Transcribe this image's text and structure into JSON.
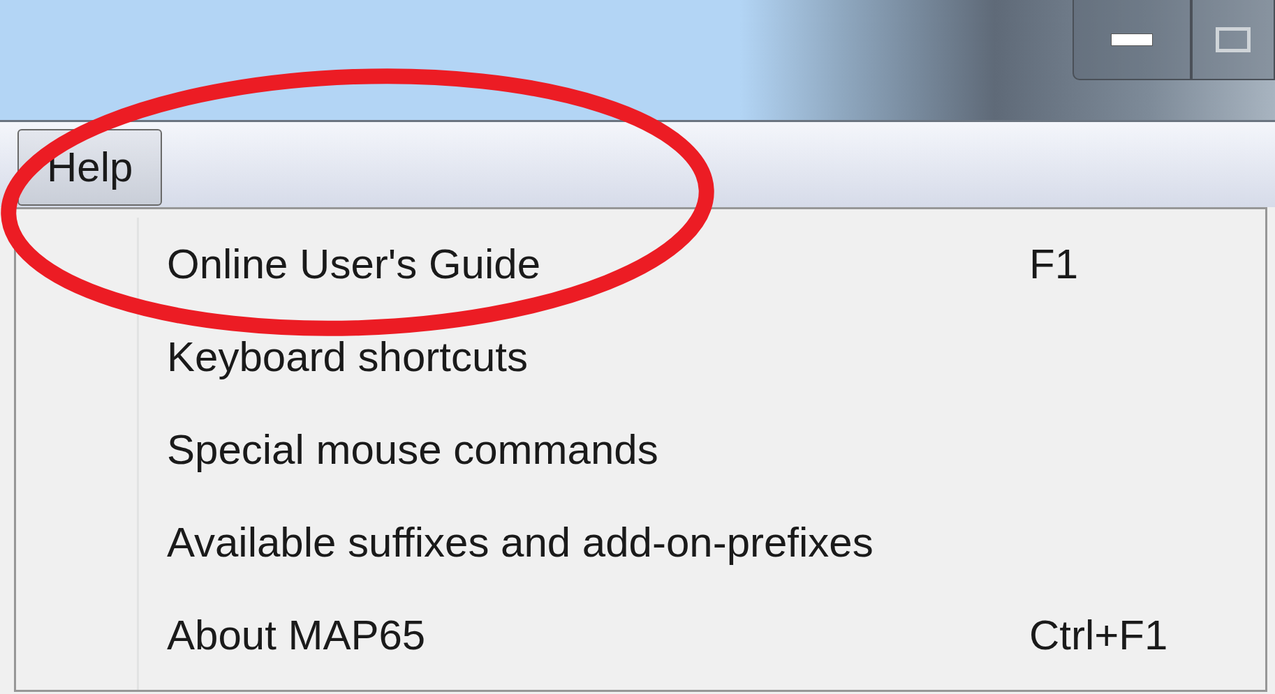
{
  "menu_bar": [
    {
      "label": "Help",
      "selected": true
    }
  ],
  "menu": {
    "items": [
      {
        "label": "Online User's Guide",
        "shortcut": "F1"
      },
      {
        "label": "Keyboard shortcuts"
      },
      {
        "label": "Special mouse commands"
      },
      {
        "label": "Available suffixes and add-on-prefixes"
      },
      {
        "label": "About MAP65",
        "shortcut": "Ctrl+F1"
      }
    ]
  }
}
